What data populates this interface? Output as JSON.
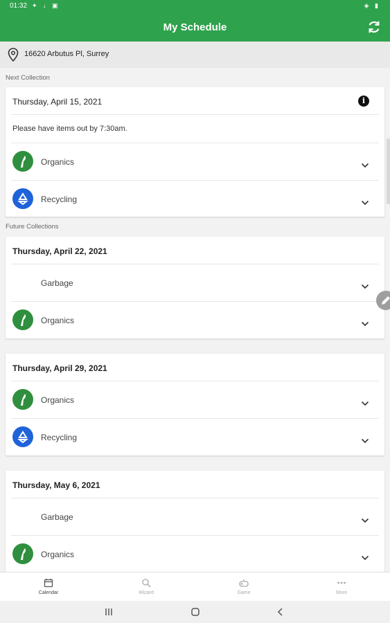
{
  "status": {
    "time": "01:32",
    "left_icons": "✦ ↓ ▣",
    "right_icons": "◈ ▮"
  },
  "header": {
    "title": "My Schedule",
    "refresh_icon": "refresh-icon"
  },
  "address": {
    "text": "16620 Arbutus Pl, Surrey",
    "icon": "location-pin-icon"
  },
  "next": {
    "section_label": "Next Collection",
    "date": "Thursday, April 15, 2021",
    "note": "Please have items out by 7:30am.",
    "items": [
      {
        "label": "Organics",
        "type": "organics"
      },
      {
        "label": "Recycling",
        "type": "recycling"
      }
    ]
  },
  "future": {
    "section_label": "Future Collections",
    "cards": [
      {
        "date": "Thursday, April 22, 2021",
        "items": [
          {
            "label": "Garbage",
            "type": "garbage"
          },
          {
            "label": "Organics",
            "type": "organics"
          }
        ]
      },
      {
        "date": "Thursday, April 29, 2021",
        "items": [
          {
            "label": "Organics",
            "type": "organics"
          },
          {
            "label": "Recycling",
            "type": "recycling"
          }
        ]
      },
      {
        "date": "Thursday, May 6, 2021",
        "items": [
          {
            "label": "Garbage",
            "type": "garbage"
          },
          {
            "label": "Organics",
            "type": "organics"
          }
        ]
      }
    ]
  },
  "bottom_nav": [
    {
      "label": "Calendar",
      "icon": "calendar-icon",
      "active": true
    },
    {
      "label": "Wizard",
      "icon": "search-icon",
      "active": false
    },
    {
      "label": "Game",
      "icon": "gamepad-icon",
      "active": false
    },
    {
      "label": "More",
      "icon": "more-icon",
      "active": false
    }
  ],
  "colors": {
    "brand_green": "#2ea24c",
    "organics": "#2f8f3e",
    "recycling": "#1f63d9"
  }
}
